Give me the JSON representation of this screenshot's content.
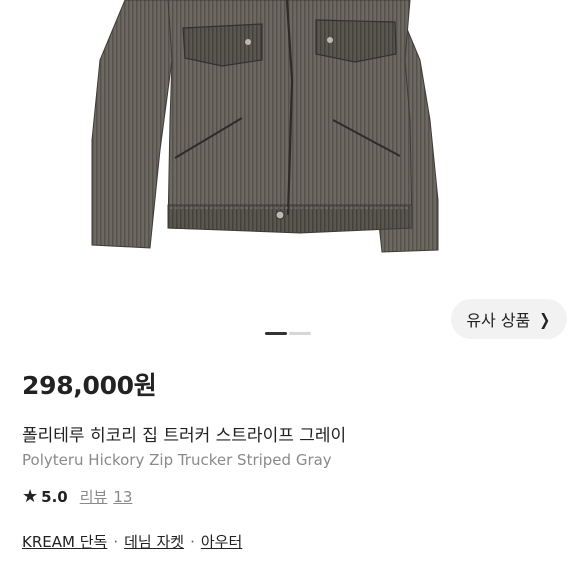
{
  "similar": {
    "label": "유사 상품"
  },
  "carousel": {
    "total": 2,
    "active": 0
  },
  "product": {
    "price": "298,000원",
    "name_ko": "폴리테루 히코리 집 트러커 스트라이프 그레이",
    "name_en": "Polyteru Hickory Zip Trucker Striped Gray",
    "rating": "5.0",
    "review_label": "리뷰",
    "review_count": "13"
  },
  "tags": {
    "items": [
      "KREAM 단독",
      "데님 자켓",
      "아우터"
    ],
    "separator": "·"
  },
  "colors": {
    "jacket": "#6b6760",
    "jacket_dark": "#4a4742"
  }
}
